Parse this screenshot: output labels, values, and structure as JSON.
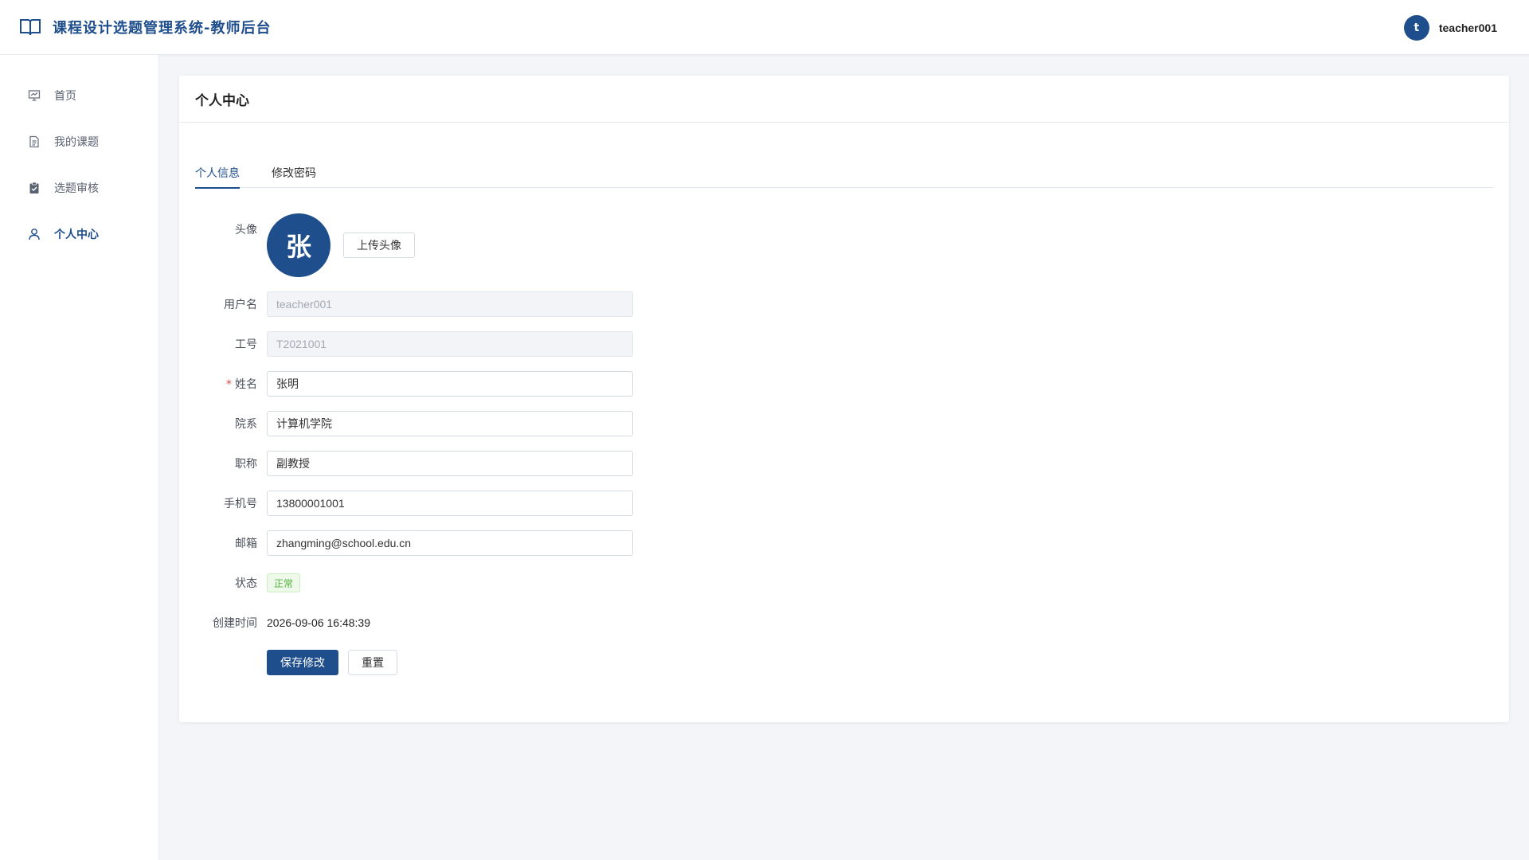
{
  "header": {
    "brand_icon": "book-open-icon",
    "title": "课程设计选题管理系统-教师后台",
    "user": {
      "avatar_letter": "t",
      "name": "teacher001"
    }
  },
  "sidebar": {
    "items": [
      {
        "label": "首页",
        "icon": "presentation-icon"
      },
      {
        "label": "我的课题",
        "icon": "document-icon"
      },
      {
        "label": "选题审核",
        "icon": "clipboard-check-icon"
      },
      {
        "label": "个人中心",
        "icon": "user-icon",
        "active": true
      }
    ]
  },
  "main": {
    "title": "个人中心",
    "tabs": [
      {
        "label": "个人信息",
        "active": true
      },
      {
        "label": "修改密码"
      }
    ],
    "form": {
      "avatar": {
        "label": "头像",
        "letter": "张",
        "upload_label": "上传头像"
      },
      "username": {
        "label": "用户名",
        "value": "teacher001"
      },
      "employee_id": {
        "label": "工号",
        "value": "T2021001"
      },
      "name": {
        "label": "姓名",
        "required_mark": "*",
        "value": "张明"
      },
      "department": {
        "label": "院系",
        "value": "计算机学院"
      },
      "title": {
        "label": "职称",
        "value": "副教授"
      },
      "phone": {
        "label": "手机号",
        "value": "13800001001"
      },
      "email": {
        "label": "邮箱",
        "value": "zhangming@school.edu.cn"
      },
      "status": {
        "label": "状态",
        "value": "正常"
      },
      "created_at": {
        "label": "创建时间",
        "value": "2026-09-06 16:48:39"
      },
      "save_label": "保存修改",
      "reset_label": "重置"
    }
  },
  "colors": {
    "primary": "#1f4e8c",
    "success": "#4fb23a",
    "background": "#f3f5f9",
    "required": "#e24b4b"
  }
}
